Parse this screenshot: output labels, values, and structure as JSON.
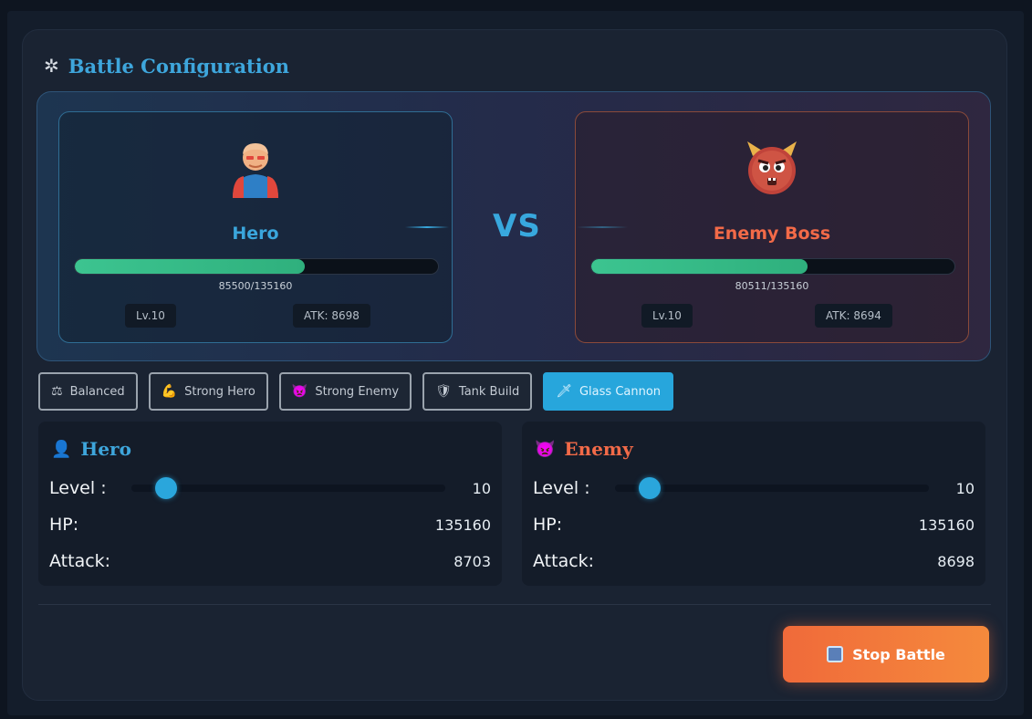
{
  "panel": {
    "title": "Battle Configuration",
    "icon": "gear-icon"
  },
  "arena": {
    "hero": {
      "name": "Hero",
      "hp_text": "85500/135160",
      "hp_fraction": 0.6326,
      "level": "Lv.10",
      "attack": "ATK: 8698"
    },
    "vs": "VS",
    "enemy": {
      "name": "Enemy Boss",
      "hp_text": "80511/135160",
      "hp_fraction": 0.5957,
      "level": "Lv.10",
      "attack": "ATK: 8694"
    }
  },
  "presets": [
    {
      "label": "Balanced",
      "icon": "scale-icon",
      "glyph": "⚖",
      "active": false
    },
    {
      "label": "Strong Hero",
      "icon": "muscle-icon",
      "glyph": "💪",
      "active": false
    },
    {
      "label": "Strong Enemy",
      "icon": "devil-icon",
      "glyph": "👿",
      "active": false
    },
    {
      "label": "Tank Build",
      "icon": "shield-icon",
      "glyph": "🛡",
      "active": false
    },
    {
      "label": "Glass Cannon",
      "icon": "dagger-icon",
      "glyph": "🗡",
      "active": true
    }
  ],
  "hero_config": {
    "title": "Hero",
    "level_label": "Level :",
    "level_value": "10",
    "level_fraction": 0.11,
    "hp_label": "HP:",
    "hp_value": "135160",
    "attack_label": "Attack:",
    "attack_value": "8703"
  },
  "enemy_config": {
    "title": "Enemy",
    "level_label": "Level :",
    "level_value": "10",
    "level_fraction": 0.11,
    "hp_label": "HP:",
    "hp_value": "135160",
    "attack_label": "Attack:",
    "attack_value": "8698"
  },
  "stop_button": {
    "label": "Stop Battle"
  },
  "colors": {
    "accent": "#2aa6dc",
    "enemy": "#f26a48",
    "hp": "#3cc490",
    "stop": "#f06a3a"
  }
}
